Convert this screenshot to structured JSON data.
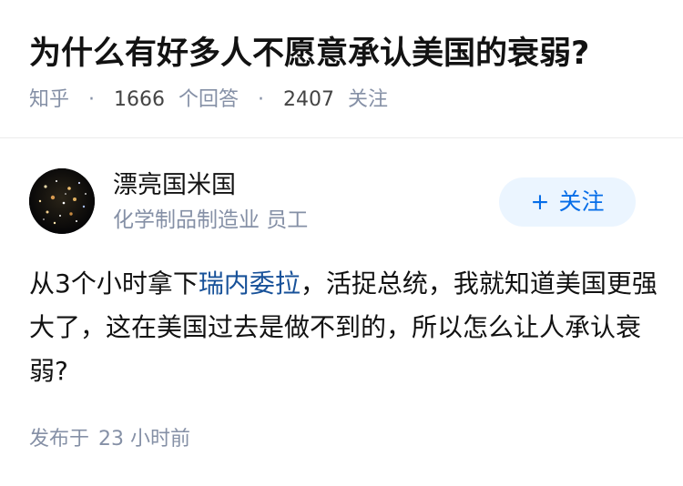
{
  "question": {
    "title": "为什么有好多人不愿意承认美国的衰弱?",
    "source": "知乎",
    "answer_count": "1666",
    "answer_label": "个回答",
    "follower_count": "2407",
    "follower_label": "关注"
  },
  "author": {
    "name": "漂亮国米国",
    "headline": "化学制品制造业 员工",
    "follow_icon": "+",
    "follow_label": "关注"
  },
  "answer": {
    "text_before_link": "从3个小时拿下",
    "link_text": "瑞内委拉",
    "text_after_link": "，活捉总统，我就知道美国更强大了，这在美国过去是做不到的，所以怎么让人承认衰弱?"
  },
  "footer": {
    "published_label": "发布于",
    "published_time": "23 小时前"
  },
  "colors": {
    "meta_gray": "#8590a6",
    "link_blue": "#175199",
    "button_bg": "#ebf5ff",
    "button_text": "#056de8"
  },
  "icons": {
    "avatar": "starfield-avatar"
  }
}
